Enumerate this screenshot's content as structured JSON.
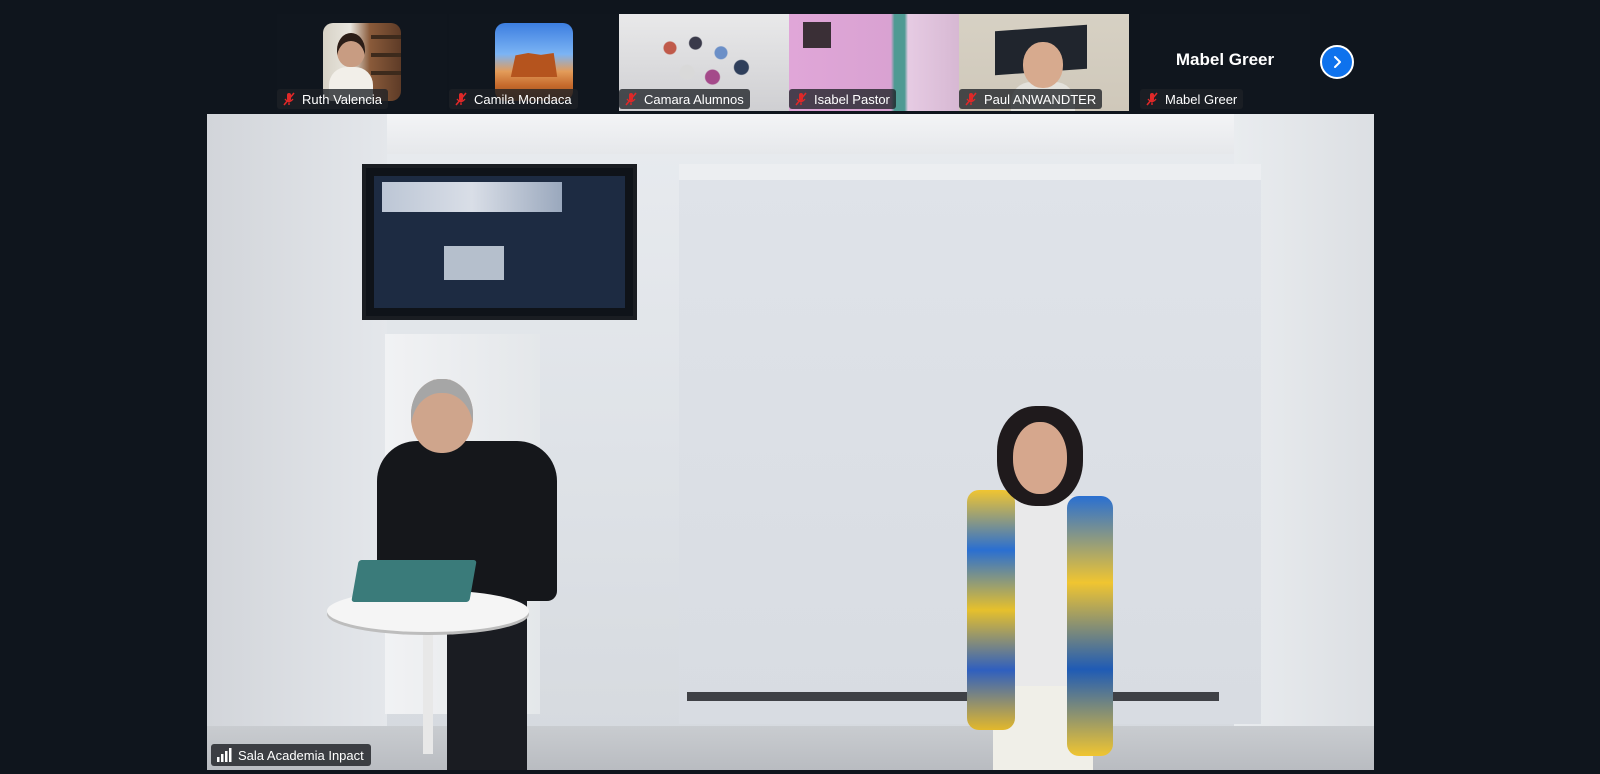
{
  "gallery": {
    "tiles": [
      {
        "name": "Ruth Valencia",
        "type": "avatar"
      },
      {
        "name": "Camila Mondaca",
        "type": "avatar"
      },
      {
        "name": "Camara Alumnos",
        "type": "video"
      },
      {
        "name": "Isabel Pastor",
        "type": "video"
      },
      {
        "name": "Paul ANWANDTER",
        "type": "video"
      },
      {
        "name": "Mabel Greer",
        "type": "name-only",
        "display_name": "Mabel Greer"
      }
    ],
    "next_icon": "chevron-right-icon"
  },
  "main_video": {
    "name": "Sala Academia Inpact",
    "connection_icon": "signal-strength-icon"
  },
  "colors": {
    "background": "#0f151d",
    "accent": "#0e72ed",
    "mic_off": "#e02828"
  }
}
